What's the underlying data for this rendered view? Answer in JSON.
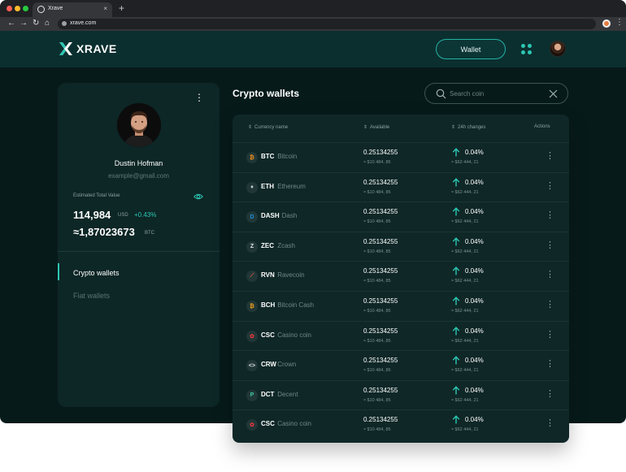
{
  "browser": {
    "tab_title": "Xrave",
    "tab_close": "×",
    "new_tab": "+",
    "url": "xrave.com",
    "nav_back": "←",
    "nav_forward": "→",
    "nav_reload": "↻",
    "nav_home": "⌂",
    "menu": "⋮"
  },
  "header": {
    "logo_text": "XRAVE",
    "wallet_button": "Wallet"
  },
  "profile": {
    "menu": "⋮",
    "name": "Dustin Hofman",
    "email": "example@gmail.com",
    "estimated_label": "Estimated Total Value",
    "usd_value": "114,984",
    "usd_unit": "USD",
    "usd_change": "+0.43%",
    "btc_value": "≈1,87023673",
    "btc_unit": "BTC"
  },
  "sidebar_nav": [
    {
      "label": "Crypto wallets",
      "active": true
    },
    {
      "label": "Fiat wallets",
      "active": false
    }
  ],
  "main": {
    "title": "Crypto wallets",
    "search_placeholder": "Search coin"
  },
  "table": {
    "headers": {
      "currency": "Currency name",
      "available": "Available",
      "changes": "24h changes",
      "actions": "Actions"
    },
    "rows": [
      {
        "symbol": "BTC",
        "name": "Bitcoin",
        "icon": "bitcoin-icon",
        "glyph": "₿",
        "color": "#f7931a",
        "amount": "0.25134255",
        "amount_usd": "≈ $10 484, 85",
        "change": "0.04%",
        "change_usd": "≈ $62 444, 21"
      },
      {
        "symbol": "ETH",
        "name": "Ethereum",
        "icon": "ethereum-icon",
        "glyph": "♦",
        "color": "#c9d6d5",
        "amount": "0.25134255",
        "amount_usd": "≈ $10 484, 85",
        "change": "0.04%",
        "change_usd": "≈ $62 444, 21"
      },
      {
        "symbol": "DASH",
        "name": "Dash",
        "icon": "dash-icon",
        "glyph": "D",
        "color": "#1c8de0",
        "amount": "0.25134255",
        "amount_usd": "≈ $10 484, 85",
        "change": "0.04%",
        "change_usd": "≈ $62 444, 21"
      },
      {
        "symbol": "ZEC",
        "name": "Zcash",
        "icon": "zcash-icon",
        "glyph": "Z",
        "color": "#dfe7e6",
        "amount": "0.25134255",
        "amount_usd": "≈ $10 484, 85",
        "change": "0.04%",
        "change_usd": "≈ $62 444, 21"
      },
      {
        "symbol": "RVN",
        "name": "Ravecoin",
        "icon": "ravencoin-icon",
        "glyph": "⟋",
        "color": "#e8613c",
        "amount": "0.25134255",
        "amount_usd": "≈ $10 484, 85",
        "change": "0.04%",
        "change_usd": "≈ $62 444, 21"
      },
      {
        "symbol": "BCH",
        "name": "Bitcoin Cash",
        "icon": "bitcoin-cash-icon",
        "glyph": "₿",
        "color": "#f7a21a",
        "amount": "0.25134255",
        "amount_usd": "≈ $10 484, 85",
        "change": "0.04%",
        "change_usd": "≈ $62 444, 21"
      },
      {
        "symbol": "CSC",
        "name": "Casino coin",
        "icon": "casino-coin-icon",
        "glyph": "✿",
        "color": "#e0363c",
        "amount": "0.25134255",
        "amount_usd": "≈ $10 484, 85",
        "change": "0.04%",
        "change_usd": "≈ $62 444, 21"
      },
      {
        "symbol": "CRW",
        "name": "Crown",
        "icon": "crown-icon",
        "glyph": "<>",
        "color": "#dfe7e6",
        "amount": "0.25134255",
        "amount_usd": "≈ $10 484, 85",
        "change": "0.04%",
        "change_usd": "≈ $62 444, 21"
      },
      {
        "symbol": "DCT",
        "name": "Decent",
        "icon": "decent-icon",
        "glyph": "P",
        "color": "#3ec8a0",
        "amount": "0.25134255",
        "amount_usd": "≈ $10 484, 85",
        "change": "0.04%",
        "change_usd": "≈ $62 444, 21"
      },
      {
        "symbol": "CSC",
        "name": "Casino coin",
        "icon": "casino-coin-icon",
        "glyph": "✿",
        "color": "#e0363c",
        "amount": "0.25134255",
        "amount_usd": "≈ $10 484, 85",
        "change": "0.04%",
        "change_usd": "≈ $62 444, 21"
      }
    ]
  },
  "colors": {
    "accent": "#2bc7b2",
    "background": "#071a1a",
    "panel": "#0d2626",
    "header": "#0b2f2f"
  }
}
